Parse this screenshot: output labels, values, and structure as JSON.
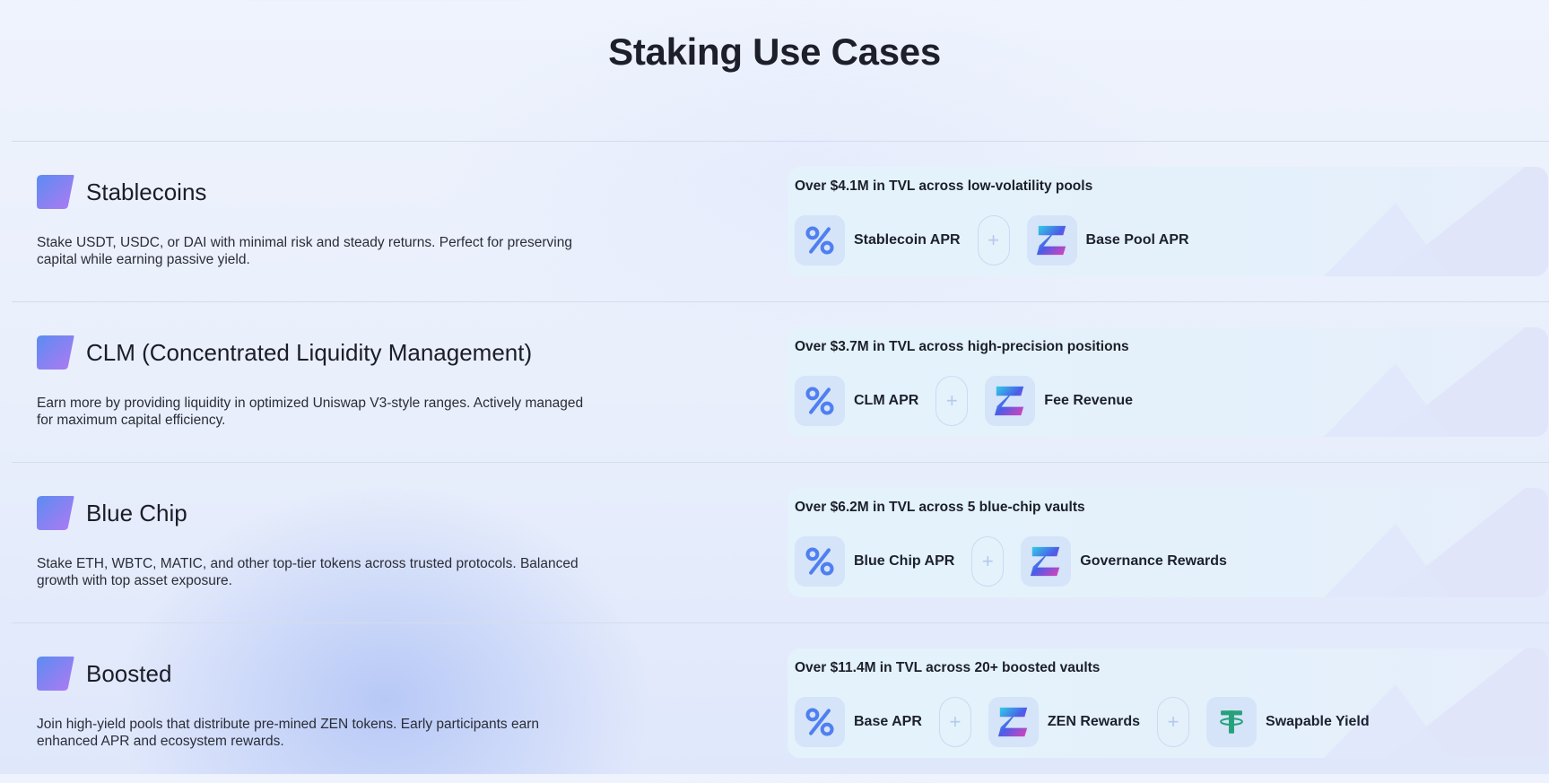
{
  "page": {
    "title": "Staking Use Cases"
  },
  "sections": [
    {
      "name": "Stablecoins",
      "description": "Stake USDT, USDC, or DAI with minimal risk and steady returns. Perfect for preserving capital while earning passive yield.",
      "tvl": "Over $4.1M in TVL across low-volatility pools",
      "chips": [
        {
          "icon": "percent-icon",
          "label": "Stablecoin APR"
        },
        {
          "icon": "zen-token-icon",
          "label": "Base Pool APR"
        }
      ]
    },
    {
      "name": "CLM (Concentrated Liquidity Management)",
      "description": "Earn more by providing liquidity in optimized Uniswap V3-style ranges. Actively managed for maximum capital efficiency.",
      "tvl": "Over $3.7M in TVL across high-precision positions",
      "chips": [
        {
          "icon": "percent-icon",
          "label": "CLM APR"
        },
        {
          "icon": "zen-token-icon",
          "label": "Fee Revenue"
        }
      ]
    },
    {
      "name": "Blue Chip",
      "description": "Stake ETH, WBTC, MATIC, and other top-tier tokens across trusted protocols. Balanced growth with top asset exposure.",
      "tvl": "Over $6.2M in TVL across 5 blue-chip vaults",
      "chips": [
        {
          "icon": "percent-icon",
          "label": "Blue Chip APR"
        },
        {
          "icon": "zen-token-icon",
          "label": "Governance Rewards"
        }
      ]
    },
    {
      "name": "Boosted",
      "description": "Join high-yield pools that distribute pre-mined ZEN tokens. Early participants earn enhanced APR and ecosystem rewards.",
      "tvl": "Over $11.4M in TVL across 20+ boosted vaults",
      "chips": [
        {
          "icon": "percent-icon",
          "label": "Base APR"
        },
        {
          "icon": "zen-token-icon",
          "label": "ZEN Rewards"
        },
        {
          "icon": "tether-icon",
          "label": "Swapable Yield"
        }
      ]
    }
  ],
  "plus_symbol": "+",
  "colors": {
    "accent_blue": "#4f7ff0",
    "tether_green": "#26a17b",
    "logo_gradient_start": "#5b8cf2",
    "logo_gradient_end": "#b079f3"
  }
}
